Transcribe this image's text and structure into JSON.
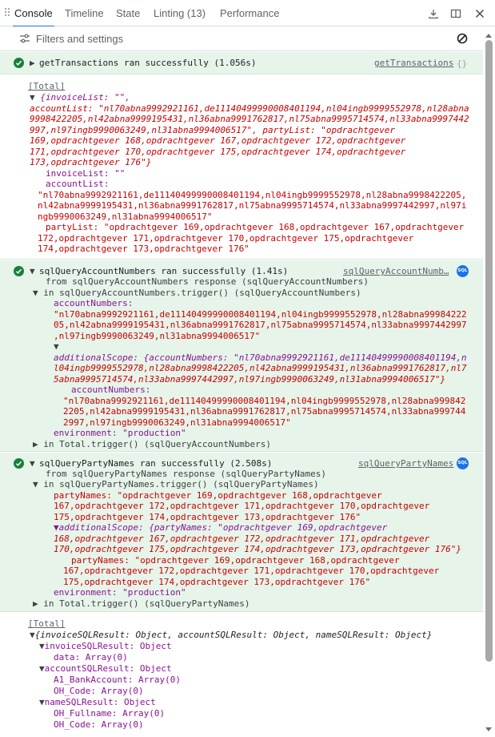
{
  "tabs": [
    {
      "label": "Console"
    },
    {
      "label": "Timeline"
    },
    {
      "label": "State"
    },
    {
      "label": "Linting (13)"
    },
    {
      "label": "Performance"
    }
  ],
  "filter": {
    "label": "Filters and settings"
  },
  "colors": {
    "accent": "#1a73e8",
    "success_bg": "#e6f4ea",
    "success": "#188038",
    "key": "#881391",
    "string": "#c80000"
  },
  "msg1": {
    "text": "getTransactions ran successfully (1.056s)",
    "source": "getTransactions"
  },
  "total1": {
    "label": "[Total]",
    "l1a": "{invoiceList: \"\",",
    "l2a": "accountList: \"nl70abna9992921161,de11140499990008401194,nl04ingb9999552978,nl28abna",
    "l3a": "9998422205,nl42abna9999195431,nl36abna9991762817,nl75abna9995714574,nl33abna9997442",
    "l4a": "997,nl97ingb9990063249,nl31abna9994006517\", partyList: \"opdrachtgever",
    "l5a": "169,opdrachtgever 168,opdrachtgever 167,opdrachtgever 172,opdrachtgever",
    "l6a": "171,opdrachtgever 170,opdrachtgever 175,opdrachtgever 174,opdrachtgever",
    "l7a": "173,opdrachtgever 176\"}",
    "l8": "invoiceList: \"\"",
    "l9": "accountList:",
    "l10": "\"nl70abna9992921161,de11140499990008401194,nl04ingb9999552978,nl28abna9998422205,",
    "l11": "nl42abna9999195431,nl36abna9991762817,nl75abna9995714574,nl33abna9997442997,nl97i",
    "l12": "ngb9990063249,nl31abna9994006517\"",
    "l13": "partyList: \"opdrachtgever 169,opdrachtgever 168,opdrachtgever 167,opdrachtgever",
    "l14": "172,opdrachtgever 171,opdrachtgever 170,opdrachtgever 175,opdrachtgever",
    "l15": "174,opdrachtgever 173,opdrachtgever 176\""
  },
  "msg2": {
    "text": "sqlQueryAccountNumbers ran successfully (1.41s)",
    "source": "sqlQueryAccountNumb…",
    "badge": "SQL",
    "from": "from sqlQueryAccountNumbers response (sqlQueryAccountNumbers)",
    "in": "in sqlQueryAccountNumbers.trigger() (sqlQueryAccountNumbers)",
    "l1": "accountNumbers:",
    "l2": "\"nl70abna9992921161,de11140499990008401194,nl04ingb9999552978,nl28abna99984222",
    "l3": "05,nl42abna9999195431,nl36abna9991762817,nl75abna9995714574,nl33abna9997442997",
    "l4": ",nl97ingb9990063249,nl31abna9994006517\"",
    "l5": "▼",
    "l6": "additionalScope: {accountNumbers: \"nl70abna9992921161,de11140499990008401194,n",
    "l7": "l04ingb9999552978,nl28abna9998422205,nl42abna9999195431,nl36abna9991762817,nl7",
    "l8": "5abna9995714574,nl33abna9997442997,nl97ingb9990063249,nl31abna9994006517\"}",
    "l9": "accountNumbers:",
    "l10": "\"nl70abna9992921161,de11140499990008401194,nl04ingb9999552978,nl28abna999842",
    "l11": "2205,nl42abna9999195431,nl36abna9991762817,nl75abna9995714574,nl33abna999744",
    "l12": "2997,nl97ingb9990063249,nl31abna9994006517\"",
    "l13": "environment: \"production\"",
    "l14": "in Total.trigger() (sqlQueryAccountNumbers)"
  },
  "msg3": {
    "text": "sqlQueryPartyNames ran successfully (2.508s)",
    "source": "sqlQueryPartyNames",
    "badge": "SQL",
    "from": "from sqlQueryPartyNames response (sqlQueryPartyNames)",
    "in": "in sqlQueryPartyNames.trigger() (sqlQueryPartyNames)",
    "l1": "partyNames: \"opdrachtgever 169,opdrachtgever 168,opdrachtgever",
    "l2": "167,opdrachtgever 172,opdrachtgever 171,opdrachtgever 170,opdrachtgever",
    "l3": "175,opdrachtgever 174,opdrachtgever 173,opdrachtgever 176\"",
    "l4": "▼additionalScope: {partyNames: \"opdrachtgever 169,opdrachtgever",
    "l5": "168,opdrachtgever 167,opdrachtgever 172,opdrachtgever 171,opdrachtgever",
    "l6": "170,opdrachtgever 175,opdrachtgever 174,opdrachtgever 173,opdrachtgever 176\"}",
    "l7": "partyNames: \"opdrachtgever 169,opdrachtgever 168,opdrachtgever",
    "l8": "167,opdrachtgever 172,opdrachtgever 171,opdrachtgever 170,opdrachtgever",
    "l9": "175,opdrachtgever 174,opdrachtgever 173,opdrachtgever 176\"",
    "l10": "environment: \"production\"",
    "l11": "in Total.trigger() (sqlQueryPartyNames)"
  },
  "total2": {
    "label": "[Total]",
    "l1": "{invoiceSQLResult: Object, accountSQLResult: Object, nameSQLResult: Object}",
    "l2": "invoiceSQLResult: Object",
    "l3": "data: Array(0)",
    "l4": "accountSQLResult: Object",
    "l5": "A1_BankAccount: Array(0)",
    "l6": "OH_Code: Array(0)",
    "l7": "nameSQLResult: Object",
    "l8": "OH_Fullname: Array(0)",
    "l9": "OH_Code: Array(0)"
  }
}
